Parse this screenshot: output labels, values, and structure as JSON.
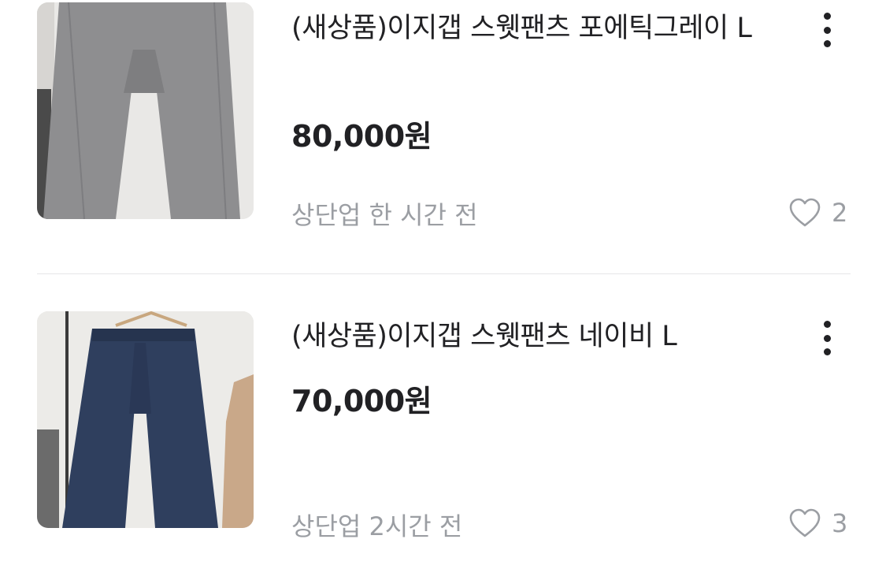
{
  "listings": [
    {
      "title": "(새상품)이지갭 스웻팬츠 포에틱그레이 L",
      "price": "80,000원",
      "meta": "상단업 한 시간 전",
      "likes": "2",
      "image_icon": "gray-sweatpants-photo"
    },
    {
      "title": "(새상품)이지갭 스웻팬츠 네이비 L",
      "price": "70,000원",
      "meta": "상단업 2시간 전",
      "likes": "3",
      "image_icon": "navy-sweatpants-photo"
    }
  ],
  "colors": {
    "text_primary": "#212124",
    "text_secondary": "#9b9ea3",
    "divider": "#e6e6e8",
    "gray_pants": "#8f8f90",
    "navy_pants": "#2e3f5e"
  },
  "icons": {
    "more": "more-vertical-icon",
    "like": "heart-outline-icon"
  }
}
